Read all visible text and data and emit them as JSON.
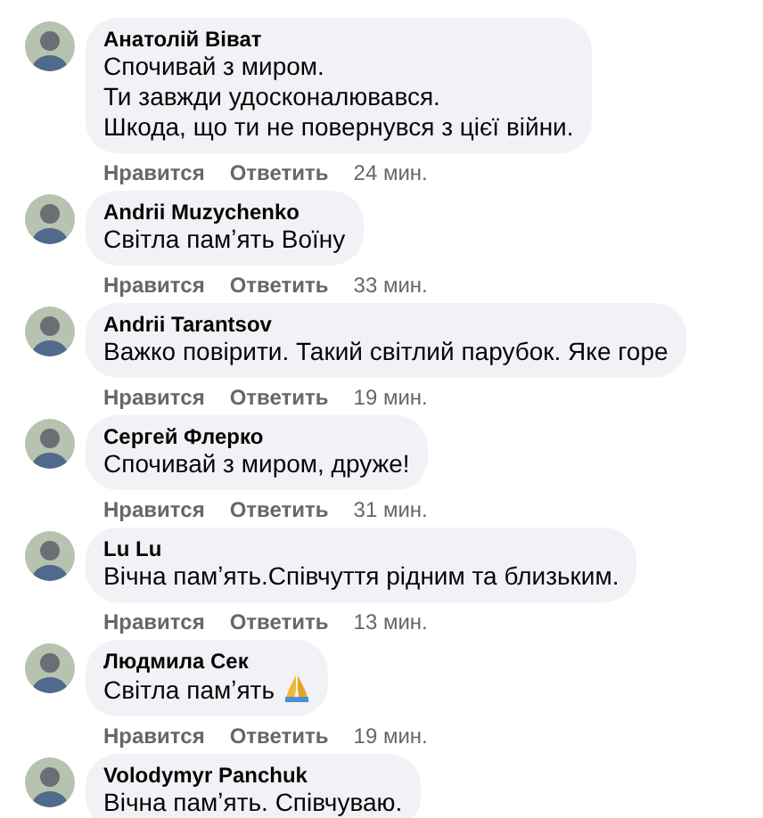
{
  "comments": [
    {
      "author": "Анатолій Віват",
      "lines": [
        "Спочивай з миром.",
        "Ти завжди удосконалювався.",
        "Шкода, що ти не повернувся з цієї війни."
      ],
      "actions": [
        "Нравится",
        "Ответить"
      ],
      "time": "24 мин."
    },
    {
      "author": "Andrii Muzychenko",
      "lines": [
        "Світла памʼять Воїну"
      ],
      "actions": [
        "Нравится",
        "Ответить"
      ],
      "time": "33 мин."
    },
    {
      "author": "Andrii Tarantsov",
      "lines": [
        "Важко повірити. Такий світлий парубок. Яке горе"
      ],
      "actions": [
        "Нравится",
        "Ответить"
      ],
      "time": "19 мин."
    },
    {
      "author": "Сергей Флерко",
      "lines": [
        "Спочивай з миром, друже!"
      ],
      "actions": [
        "Нравится",
        "Ответить"
      ],
      "time": "31 мин."
    },
    {
      "author": "Lu Lu",
      "lines": [
        "Вічна памʼять.Співчуття рідним та близьким."
      ],
      "actions": [
        "Нравится",
        "Ответить"
      ],
      "time": "13 мин."
    },
    {
      "author": "Людмила Сек",
      "lines": [
        "Світла памʼять"
      ],
      "trailing_icon": true,
      "actions": [
        "Нравится",
        "Ответить"
      ],
      "time": "19 мин."
    },
    {
      "author": "Volodymyr Panchuk",
      "lines": [
        "Вічна памʼять. Співчуваю."
      ]
    }
  ]
}
